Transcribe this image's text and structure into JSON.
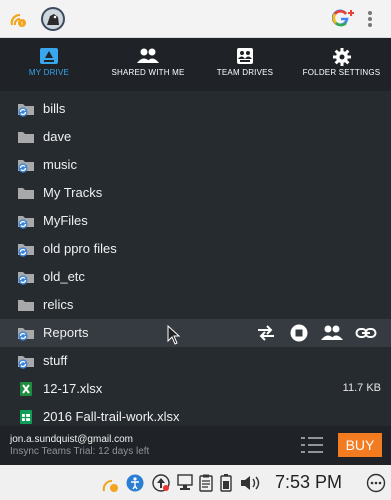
{
  "tabs": [
    {
      "label": "MY DRIVE",
      "icon": "drive-icon",
      "active": true
    },
    {
      "label": "SHARED WITH ME",
      "icon": "people-icon",
      "active": false
    },
    {
      "label": "TEAM DRIVES",
      "icon": "team-drive-icon",
      "active": false
    },
    {
      "label": "FOLDER SETTINGS",
      "icon": "gear-icon",
      "active": false
    }
  ],
  "files": [
    {
      "name": "bills",
      "type": "synced-folder"
    },
    {
      "name": "dave",
      "type": "folder"
    },
    {
      "name": "music",
      "type": "synced-folder"
    },
    {
      "name": "My Tracks",
      "type": "folder"
    },
    {
      "name": "MyFiles",
      "type": "synced-folder"
    },
    {
      "name": "old ppro files",
      "type": "synced-folder"
    },
    {
      "name": "old_etc",
      "type": "synced-folder"
    },
    {
      "name": "relics",
      "type": "folder"
    },
    {
      "name": "Reports",
      "type": "synced-folder"
    },
    {
      "name": "stuff",
      "type": "synced-folder"
    },
    {
      "name": "12-17.xlsx",
      "type": "excel",
      "size": "11.7 KB"
    },
    {
      "name": "2016 Fall-trail-work.xlsx",
      "type": "sheets"
    }
  ],
  "footer": {
    "email": "jon.a.sundquist@gmail.com",
    "trial": "Insync Teams Trial: 12 days left",
    "buy_label": "BUY"
  },
  "tray": {
    "time": "7:53 PM"
  },
  "colors": {
    "accent": "#39a6ee",
    "buy": "#f47c20",
    "background": "#262b30"
  }
}
